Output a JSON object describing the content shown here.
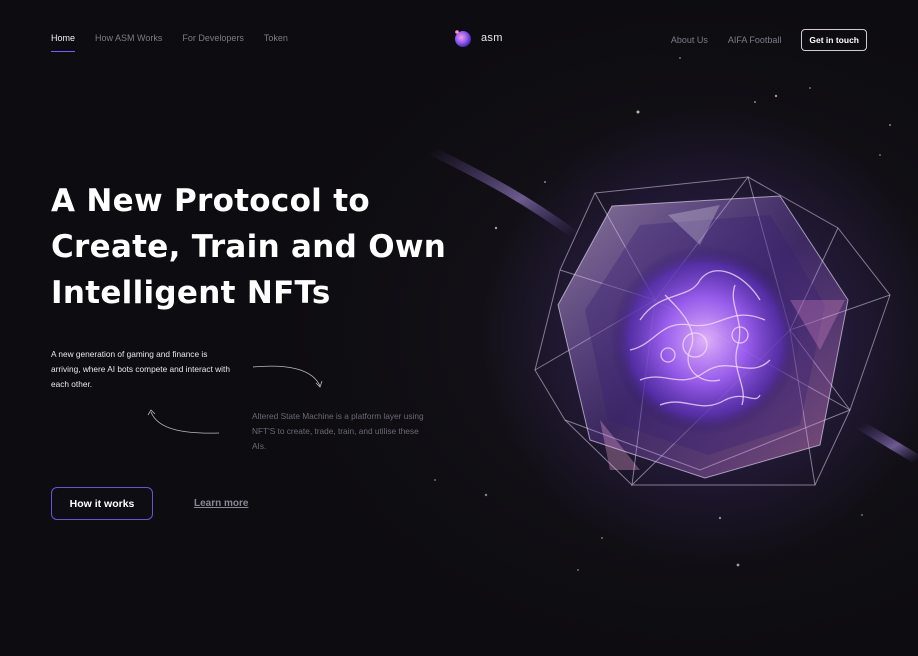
{
  "nav": {
    "left": [
      "Home",
      "How ASM Works",
      "For Developers",
      "Token"
    ],
    "right": [
      "About Us",
      "AIFA Football"
    ],
    "cta": "Get in touch"
  },
  "logo": {
    "text": "asm",
    "icon": "asm-orb-icon"
  },
  "hero": {
    "title_lines": [
      "A New Protocol to",
      "Create, Train and Own",
      "Intelligent NFTs"
    ],
    "desc_primary": "A new generation of gaming and finance is arriving, where AI bots compete and interact with each other.",
    "desc_secondary": "Altered State Machine is a platform layer using NFT'S to create, trade, train, and utilise these AIs.",
    "primary_button": "How it works",
    "secondary_link": "Learn more",
    "artwork": "glass-crystal-brain-orb",
    "decorative_arrows": [
      "curved-arrow-down-right-icon",
      "curved-arrow-up-left-icon"
    ]
  },
  "colors": {
    "background": "#0d0c10",
    "accent": "#7c5cff",
    "text": "#ffffff",
    "muted": "#7f7b88"
  }
}
